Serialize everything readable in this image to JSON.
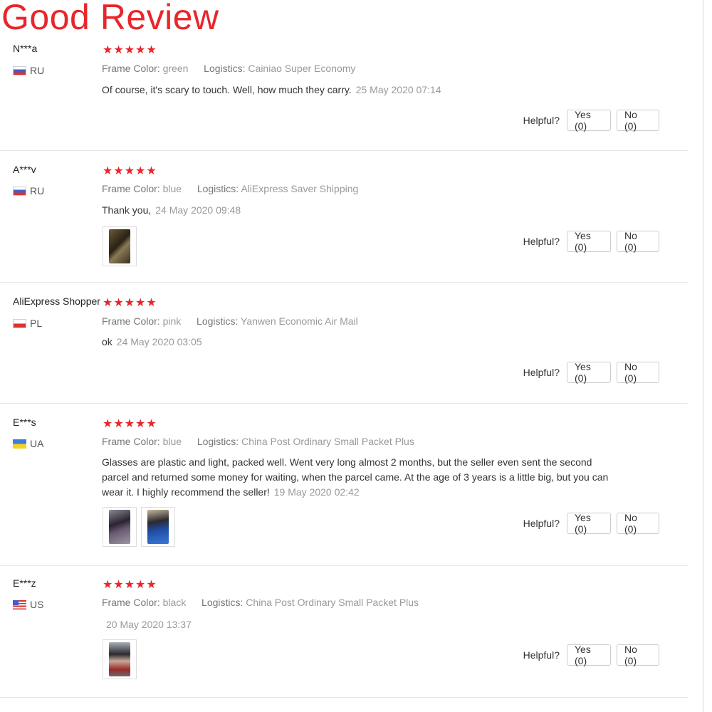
{
  "page_title": "Good Review",
  "helpful_label": "Helpful?",
  "yes_label": "Yes (0)",
  "no_label": "No (0)",
  "frame_color_label": "Frame Color:",
  "logistics_label": "Logistics:",
  "accent_color": "#e8262b",
  "star_icon": "star-icon",
  "reviews": [
    {
      "user": "N***a",
      "country": "RU",
      "flag": "russia-flag-icon",
      "stars": 5,
      "frame_color": "green",
      "logistics": "Cainiao Super Economy",
      "text": "Of course, it's scary to touch. Well, how much they carry.",
      "date": "25 May 2020 07:14",
      "photos": 0
    },
    {
      "user": "A***v",
      "country": "RU",
      "flag": "russia-flag-icon",
      "stars": 5,
      "frame_color": "blue",
      "logistics": "AliExpress Saver Shipping",
      "text": "Thank you,",
      "date": "24 May 2020 09:48",
      "photos": 1
    },
    {
      "user": "AliExpress Shopper",
      "country": "PL",
      "flag": "poland-flag-icon",
      "stars": 5,
      "frame_color": "pink",
      "logistics": "Yanwen Economic Air Mail",
      "text": "ok",
      "date": "24 May 2020 03:05",
      "photos": 0
    },
    {
      "user": "E***s",
      "country": "UA",
      "flag": "ukraine-flag-icon",
      "stars": 5,
      "frame_color": "blue",
      "logistics": "China Post Ordinary Small Packet Plus",
      "text": "Glasses are plastic and light, packed well. Went very long almost 2 months, but the seller even sent the second parcel and returned some money for waiting, when the parcel came. At the age of 3 years is a little big, but you can wear it. I highly recommend the seller!",
      "date": "19 May 2020 02:42",
      "photos": 2
    },
    {
      "user": "E***z",
      "country": "US",
      "flag": "usa-flag-icon",
      "stars": 5,
      "frame_color": "black",
      "logistics": "China Post Ordinary Small Packet Plus",
      "text": "",
      "date": "20 May 2020 13:37",
      "photos": 1
    }
  ]
}
